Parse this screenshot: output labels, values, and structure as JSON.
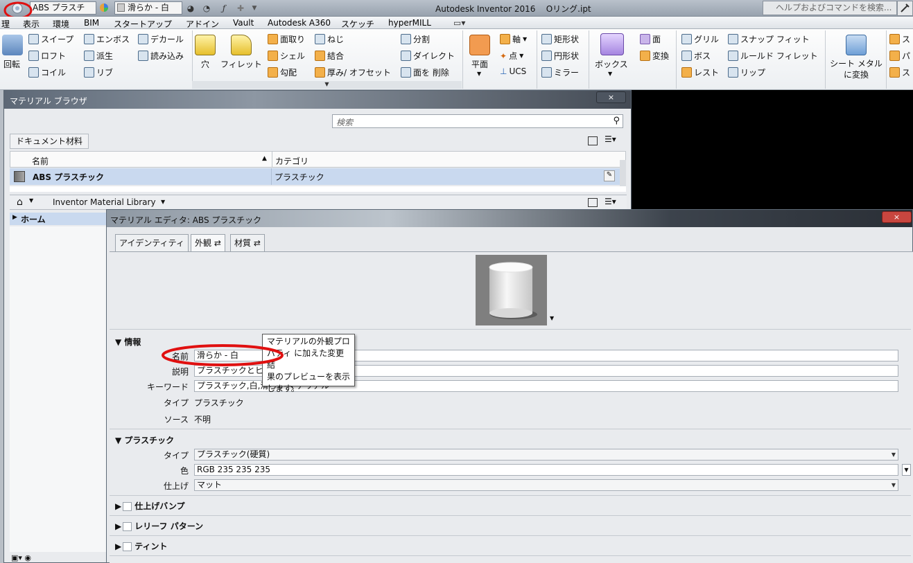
{
  "titlebar": {
    "material_combo": "ABS プラスチ",
    "appearance_combo": "滑らか - 白",
    "app_title": "Autodesk Inventor 2016",
    "file_name": "Oリング.ipt",
    "help_placeholder": "ヘルプおよびコマンドを検索..."
  },
  "menu": [
    "理",
    "表示",
    "環境",
    "BIM",
    "スタートアップ",
    "アドイン",
    "Vault",
    "Autodesk A360",
    "スケッチ",
    "hyperMILL"
  ],
  "ribbon": {
    "revolve": "回転",
    "sweep": "スイープ",
    "loft": "ロフト",
    "coil": "コイル",
    "emboss": "エンボス",
    "derive": "派生",
    "rib": "リブ",
    "decal": "デカール",
    "import": "読み込み",
    "hole": "穴",
    "fillet": "フィレット",
    "chamfer": "面取り",
    "shell": "シェル",
    "draft": "勾配",
    "thread": "ねじ",
    "combine": "結合",
    "thicken": "厚み/ オフセット",
    "split": "分割",
    "direct": "ダイレクト",
    "delete_face": "面を 削除",
    "plane": "平面",
    "axis": "軸",
    "point": "点",
    "ucs": "UCS",
    "rect_pattern": "矩形状",
    "circ_pattern": "円形状",
    "mirror": "ミラー",
    "box": "ボックス",
    "face": "面",
    "convert": "変換",
    "grill": "グリル",
    "boss": "ボス",
    "rest": "レスト",
    "snap_fit": "スナップ フィット",
    "rule_fillet": "ルールド フィレット",
    "lip": "リップ",
    "sheet_metal": "シート メタル",
    "sheet_metal2": "に変換",
    "cut1": "ス",
    "cut2": "パ",
    "cut3": "ス"
  },
  "browser": {
    "title": "マテリアル ブラウザ",
    "search_placeholder": "検索",
    "doc_materials": "ドキュメント材料",
    "col_name": "名前",
    "col_category": "カテゴリ",
    "row_name": "ABS プラスチック",
    "row_category": "プラスチック",
    "library": "Inventor Material Library",
    "home": "ホーム",
    "close": "×"
  },
  "editor": {
    "title": "マテリアル エディタ: ABS プラスチック",
    "close": "×",
    "tabs": [
      "アイデンティティ",
      "外観",
      "材質"
    ],
    "info_header": "情報",
    "labels": {
      "name": "名前",
      "description": "説明",
      "keywords": "キーワード",
      "type": "タイプ",
      "source": "ソース"
    },
    "name_value": "滑らか - 白",
    "description_value": "プラスチックとヒ",
    "keywords_value": "プラスチック,白,滑らか,マテリアル",
    "type_value": "プラスチック",
    "source_value": "不明",
    "plastic_header": "プラスチック",
    "plastic_labels": {
      "type": "タイプ",
      "color": "色",
      "finish": "仕上げ"
    },
    "plastic_type": "プラスチック(硬質)",
    "color_value": "RGB 235 235 235",
    "finish_value": "マット",
    "collapsed": [
      "仕上げバンプ",
      "レリーフ パターン",
      "ティント"
    ],
    "tooltip": [
      "マテリアルの外観プロ",
      "パティ に加えた変更結",
      "果のプレビューを表示",
      "します。"
    ]
  },
  "colors": {
    "annotation_red": "#e01010",
    "selection_blue": "#c9d9ef"
  }
}
